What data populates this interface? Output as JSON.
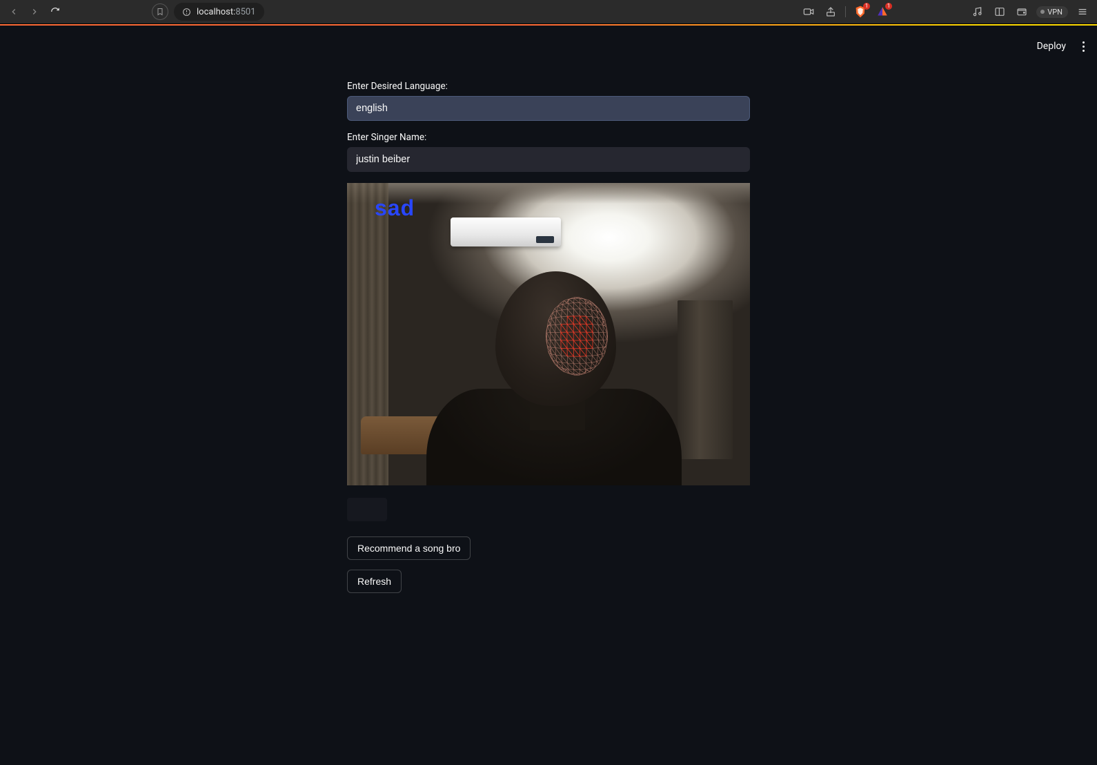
{
  "browser": {
    "url_host": "localhost:",
    "url_port": "8501",
    "shield_count": "1",
    "rewards_count": "1",
    "vpn_label": "VPN"
  },
  "toolbar": {
    "deploy_label": "Deploy"
  },
  "form": {
    "language_label": "Enter Desired Language:",
    "language_value": "english",
    "singer_label": "Enter Singer Name:",
    "singer_value": "justin beiber"
  },
  "video": {
    "emotion_text": "sad"
  },
  "buttons": {
    "recommend_label": "Recommend a song bro",
    "refresh_label": "Refresh"
  }
}
